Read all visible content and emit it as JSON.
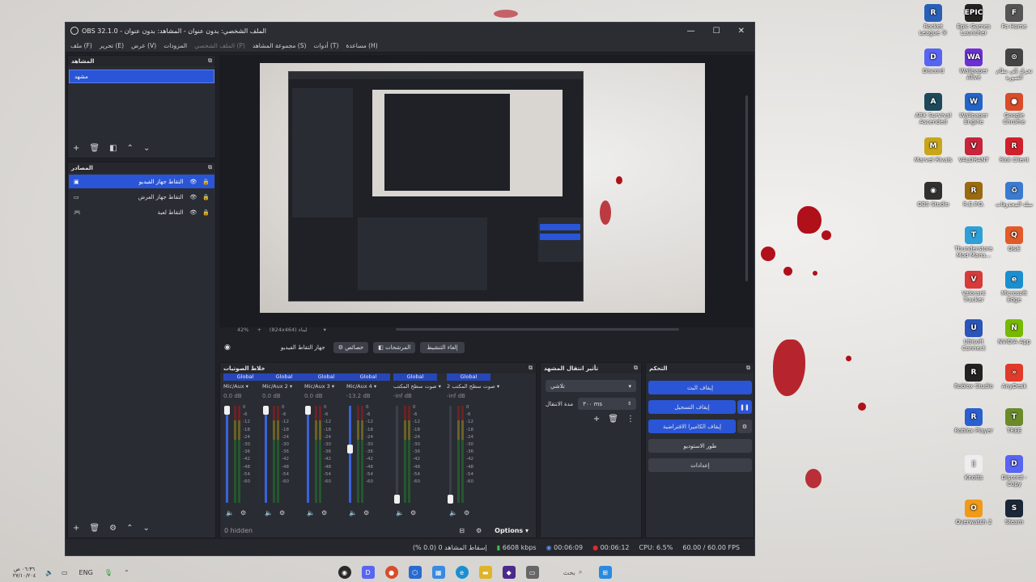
{
  "window": {
    "title": "OBS 32.1.0 - الملف الشخصي: بدون عنوان - المشاهد: بدون عنوان"
  },
  "menu": {
    "file": "ملف (F)",
    "edit": "تحرير (E)",
    "view": "عرض (V)",
    "docks": "المزودات",
    "profile": "الملف الشخصي (P)",
    "scene_collection": "مجموعة المشاهد (S)",
    "tools": "أدوات (T)",
    "help": "مساعدة (H)"
  },
  "scenes": {
    "title": "المشاهد",
    "items": [
      "مشهد"
    ]
  },
  "sources": {
    "title": "المصادر",
    "items": [
      "التقاط جهاز الفيديو",
      "التقاط جهاز العرض",
      "التقاط لعبة"
    ]
  },
  "preview_bar": {
    "zoom": "42%",
    "resolution": "(824x464) لبناء"
  },
  "context_bar": {
    "source": "جهاز التقاط الفيديو",
    "properties": "خصائص",
    "filters": "المرشحات",
    "deactivate": "إلغاء التنشيط"
  },
  "mixer": {
    "title": "خلاط الصوتيات",
    "hidden": "0 hidden",
    "options": "Options",
    "channels": [
      {
        "head": "Global",
        "name": "Mic/Aux",
        "db": "0.0 dB",
        "level": 1.0
      },
      {
        "head": "Global",
        "name": "Mic/Aux 2",
        "db": "0.0 dB",
        "level": 1.0
      },
      {
        "head": "Global",
        "name": "Mic/Aux 3",
        "db": "0.0 dB",
        "level": 1.0
      },
      {
        "head": "Global",
        "name": "Mic/Aux 4",
        "db": "-13.2 dB",
        "level": 0.56
      },
      {
        "head": "Global",
        "name": "صوت سطح المكتب",
        "db": "-inf dB",
        "level": 0.0
      },
      {
        "head": "Global",
        "name": "صوت سطح المكتب 2",
        "db": "-inf dB",
        "level": 0.0
      }
    ],
    "scale": [
      "0",
      "-6",
      "-12",
      "-18",
      "-24",
      "-30",
      "-36",
      "-42",
      "-48",
      "-54",
      "-60"
    ]
  },
  "transitions": {
    "title": "تأثير انتقال المشهد",
    "type": "تلاشي",
    "duration_label": "مدة الانتقال",
    "duration": "٣٠٠ ms"
  },
  "controls": {
    "title": "التحكم",
    "stop_stream": "إيقاف البث",
    "stop_record": "إيقاف التسجيل",
    "stop_vcam": "إيقاف الكاميرا الافتراضية",
    "studio": "طور الاستوديو",
    "settings": "إعدادات"
  },
  "status": {
    "dropped": "إسقاط المشاهد 0 (0.0 %)",
    "kbps": "6608 kbps",
    "stream_time": "00:06:09",
    "rec_time": "00:06:12",
    "cpu": "CPU: 6.5%",
    "fps": "60.00 / 60.00 FPS"
  },
  "desktop_icons": [
    {
      "label": "Rocket League ®",
      "color": "#2a5fb8",
      "glyph": "R"
    },
    {
      "label": "Epic Games Launcher",
      "color": "#222",
      "glyph": "EPIC"
    },
    {
      "label": "Fo Home",
      "color": "#555",
      "glyph": "F"
    },
    {
      "label": "Discord",
      "color": "#5865f2",
      "glyph": "D"
    },
    {
      "label": "Wallpaper Alive",
      "color": "#6b2fd6",
      "glyph": "WA"
    },
    {
      "label": "تحرك إلى نظام الصورة",
      "color": "#444",
      "glyph": "⊙"
    },
    {
      "label": "ARK Survival Ascended",
      "color": "#1c4a5a",
      "glyph": "A"
    },
    {
      "label": "Wallpaper Engine",
      "color": "#2364c8",
      "glyph": "W"
    },
    {
      "label": "Google Chrome",
      "color": "#d94c2a",
      "glyph": "●"
    },
    {
      "label": "Marvel Rivals",
      "color": "#c9a51a",
      "glyph": "M"
    },
    {
      "label": "VALORANT",
      "color": "#c8243a",
      "glyph": "V"
    },
    {
      "label": "Riot Client",
      "color": "#d0202c",
      "glyph": "R"
    },
    {
      "label": "OBS Studio",
      "color": "#303030",
      "glyph": "◉"
    },
    {
      "label": "R.E.P.O.",
      "color": "#9a6a10",
      "glyph": "R"
    },
    {
      "label": "سلة المحذوفات",
      "color": "#3a7ad0",
      "glyph": "♻"
    },
    {
      "label": "Thunderstore Mod Mana...",
      "color": "#2ea0d8",
      "glyph": "T"
    },
    {
      "label": "Q&E",
      "color": "#e25a2a",
      "glyph": "Q"
    },
    {
      "label": "Valorant Tracker",
      "color": "#d83a3a",
      "glyph": "V"
    },
    {
      "label": "Microsoft Edge",
      "color": "#1a8fd0",
      "glyph": "e"
    },
    {
      "label": "Ubisoft Connect",
      "color": "#2b55b8",
      "glyph": "U"
    },
    {
      "label": "NVIDIA App",
      "color": "#76b900",
      "glyph": "N"
    },
    {
      "label": "Roblox Studio",
      "color": "#222",
      "glyph": "R"
    },
    {
      "label": "AnyDesk",
      "color": "#e03a2a",
      "glyph": "»"
    },
    {
      "label": "Roblox Player",
      "color": "#2a5fd0",
      "glyph": "R"
    },
    {
      "label": "TREE",
      "color": "#6b8a2a",
      "glyph": "T"
    },
    {
      "label": "Knotts",
      "color": "#eee",
      "glyph": "▯"
    },
    {
      "label": "Discord - Copy",
      "color": "#5865f2",
      "glyph": "D"
    },
    {
      "label": "Overwatch 2",
      "color": "#f09a1a",
      "glyph": "O"
    },
    {
      "label": "Steam",
      "color": "#1b2838",
      "glyph": "S"
    }
  ],
  "taskbar": {
    "search": "بحث",
    "lang": "ENG",
    "time": "٠٦:٣٦ ص",
    "date": "٢٧/١٠/٢٠٤"
  }
}
